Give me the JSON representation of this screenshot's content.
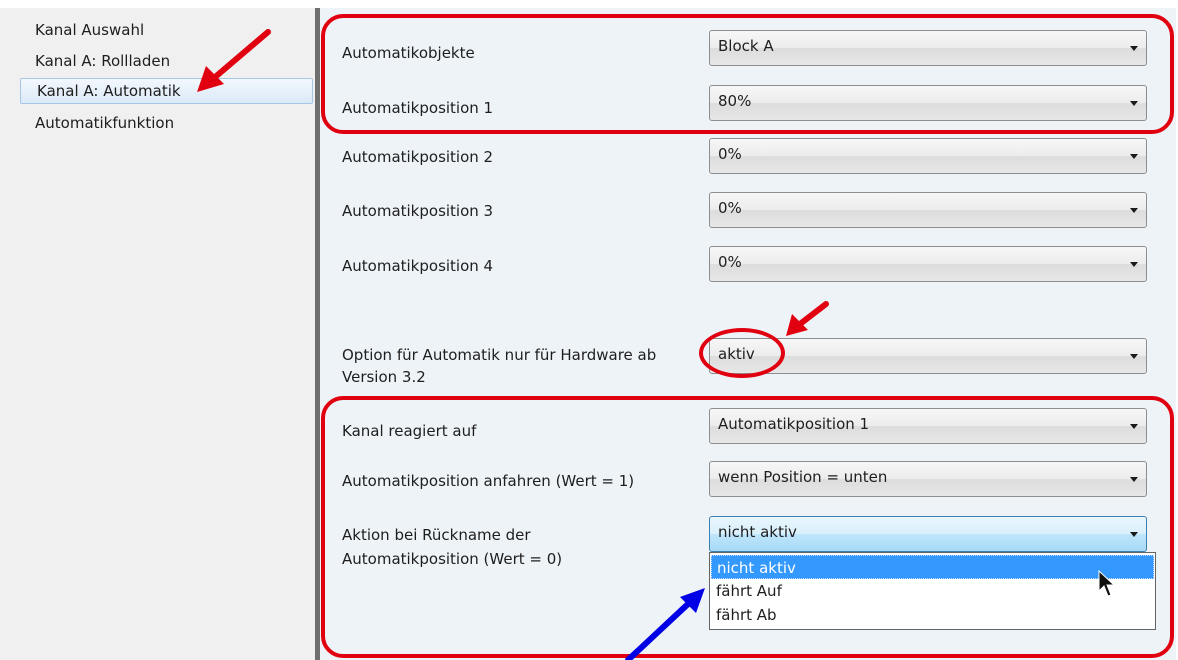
{
  "sidebar": {
    "items": [
      {
        "label": "Kanal Auswahl"
      },
      {
        "label": "Kanal A: Rollladen"
      },
      {
        "label": "Kanal A: Automatik",
        "selected": true
      },
      {
        "label": "Automatikfunktion"
      }
    ]
  },
  "params": [
    {
      "label": "Automatikobjekte",
      "value": "Block A"
    },
    {
      "label": "Automatikposition 1",
      "value": "80%"
    },
    {
      "label": "Automatikposition 2",
      "value": "0%"
    },
    {
      "label": "Automatikposition 3",
      "value": "0%"
    },
    {
      "label": "Automatikposition 4",
      "value": "0%"
    },
    {
      "label_line1": "Option für Automatik nur für Hardware ab",
      "label_line2": "Version 3.2",
      "value": "aktiv"
    },
    {
      "label": "Kanal reagiert auf",
      "value": "Automatikposition 1"
    },
    {
      "label": "Automatikposition anfahren (Wert = 1)",
      "value": "wenn Position = unten"
    },
    {
      "label_line1": "Aktion bei Rückname der",
      "label_line2": "Automatikposition (Wert = 0)",
      "value": "nicht aktiv"
    }
  ],
  "dropdown": {
    "options": [
      "nicht aktiv",
      "fährt Auf",
      "fährt Ab"
    ],
    "highlighted": "nicht aktiv"
  },
  "annotations": {
    "highlight_color": "#e1000f",
    "pointer_color": "#0000e6"
  }
}
